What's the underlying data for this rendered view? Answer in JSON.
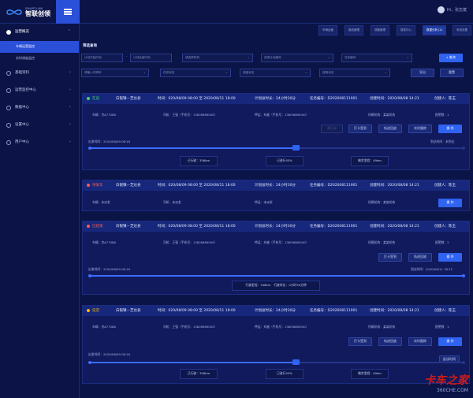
{
  "header": {
    "logo_en": "SMARTLINK",
    "logo_cn": "智联创领",
    "user_greeting": "Hi，张志斌"
  },
  "sidebar": {
    "groups": [
      {
        "label": "运营概览",
        "subs": [
          "车辆运营监控",
          "实时调度监控"
        ]
      },
      {
        "label": "基础资料"
      },
      {
        "label": "运营监控中心"
      },
      {
        "label": "数据中心"
      },
      {
        "label": "设置中心"
      },
      {
        "label": "用户中心"
      }
    ]
  },
  "tabs": [
    "车辆运营",
    "路线管理",
    "调度管理",
    "报表中心",
    "数据分析 (2)",
    "系统设置"
  ],
  "filter": {
    "title": "筛选查询",
    "start_placeholder": "计划开始时间",
    "sep": "-",
    "end_placeholder": "计划结束时间",
    "field3": "请选择机构",
    "field4": "选择计划编号",
    "field5": "任务编号",
    "search_label": "查询",
    "field6": "请输入车牌号",
    "field7": "任务状态",
    "field8": "调度状态",
    "field9": "报警状态",
    "export_label": "导出",
    "reset_label": "重置"
  },
  "cards": [
    {
      "status": "在途",
      "status_color": "#3fd46c",
      "route": "白银镇－芝达县",
      "time": "时间：020/08/09 08:00 至 2020/08/11 18:00",
      "plan": "计划总时长：24小时30分",
      "task": "任务编号：D202008111901",
      "created": "创建时间：2020/08/08 14:21",
      "creator": "创建人：陈玉",
      "vehicle": "车辆：京A77088",
      "driver": "司机：王强（手机号：13809889000）",
      "escort": "押运：刘越（手机号：13809889000）",
      "org": "所属机构：某某机构",
      "count": "报警数：1",
      "buttons": [
        "开行卡",
        "打卡签到",
        "轨迹回放",
        "实时跟踪",
        "操 作"
      ],
      "start_label": "出发时间：2020/08/09 08:16",
      "end_label": "到达时间：未到达",
      "progress": 0.55,
      "stats": [
        "已行驶：356km",
        "已进行55%",
        "剩余里程：49km"
      ]
    },
    {
      "status": "待发车",
      "status_color": "#ff5a4c",
      "route": "白银镇－芝达县",
      "time": "时间：020/08/09 08:00 至 2020/08/11 18:00",
      "plan": "计划总时长：24小时30分",
      "task": "任务编号：D202008111901",
      "created": "创建时间：2020/08/08 14:21",
      "creator": "创建人：陈玉",
      "vehicle": "车辆：未派发",
      "driver": "司机：未派发",
      "escort": "押运：未派发",
      "org": "所属机构：某某机构",
      "buttons": [
        "操 作"
      ]
    },
    {
      "status": "已结束",
      "status_color": "#ff5a4c",
      "route": "白银镇－芝达县",
      "time": "时间：020/08/09 08:00 至 2020/08/11 18:00",
      "plan": "计划总时长：24小时30分",
      "task": "任务编号：D202008111901",
      "created": "创建时间：2020/08/08 14:21",
      "creator": "创建人：陈玉",
      "vehicle": "车辆：京A77088",
      "driver": "司机：王强（手机号：13809889000）",
      "escort": "押运：刘越（手机号：13809889000）",
      "org": "所属机构：某某机构",
      "count": "报警数：2",
      "buttons": [
        "打卡签到",
        "轨迹回放",
        "操 作"
      ],
      "start_label": "出发时间：2020/08/09 08:16",
      "end_label": "到达时间：2020/08/11 18:12",
      "progress": 1.0,
      "stats": [
        "行驶里程：348km　行驶时长：0小时30分钟"
      ]
    },
    {
      "status": "延迟",
      "status_color": "#f7b500",
      "route": "白银镇－芝达县",
      "time": "时间：020/08/09 08:00 至 2020/08/11 18:00",
      "plan": "计划总时长：24小时30分",
      "task": "任务编号：D202008111901",
      "created": "创建时间：2020/08/08 14:21",
      "creator": "创建人：陈玉",
      "vehicle": "车辆：京A77088",
      "driver": "司机：王强（手机号：13809889000）",
      "escort": "押运：刘越（手机号：13809889000）",
      "org": "所属机构：某某机构",
      "count": "报警数：1",
      "buttons": [
        "打卡签到",
        "轨迹回放",
        "实时跟踪",
        "操 作"
      ],
      "start_label": "出发时间：2020/08/09 08:16",
      "end_label": "延误时间",
      "progress": 0.55,
      "stats": [
        "已行驶：356km",
        "已进行55%",
        "剩余里程：49km"
      ]
    }
  ],
  "watermark": {
    "cn": "卡车之家",
    "url": "360CHE.COM"
  }
}
